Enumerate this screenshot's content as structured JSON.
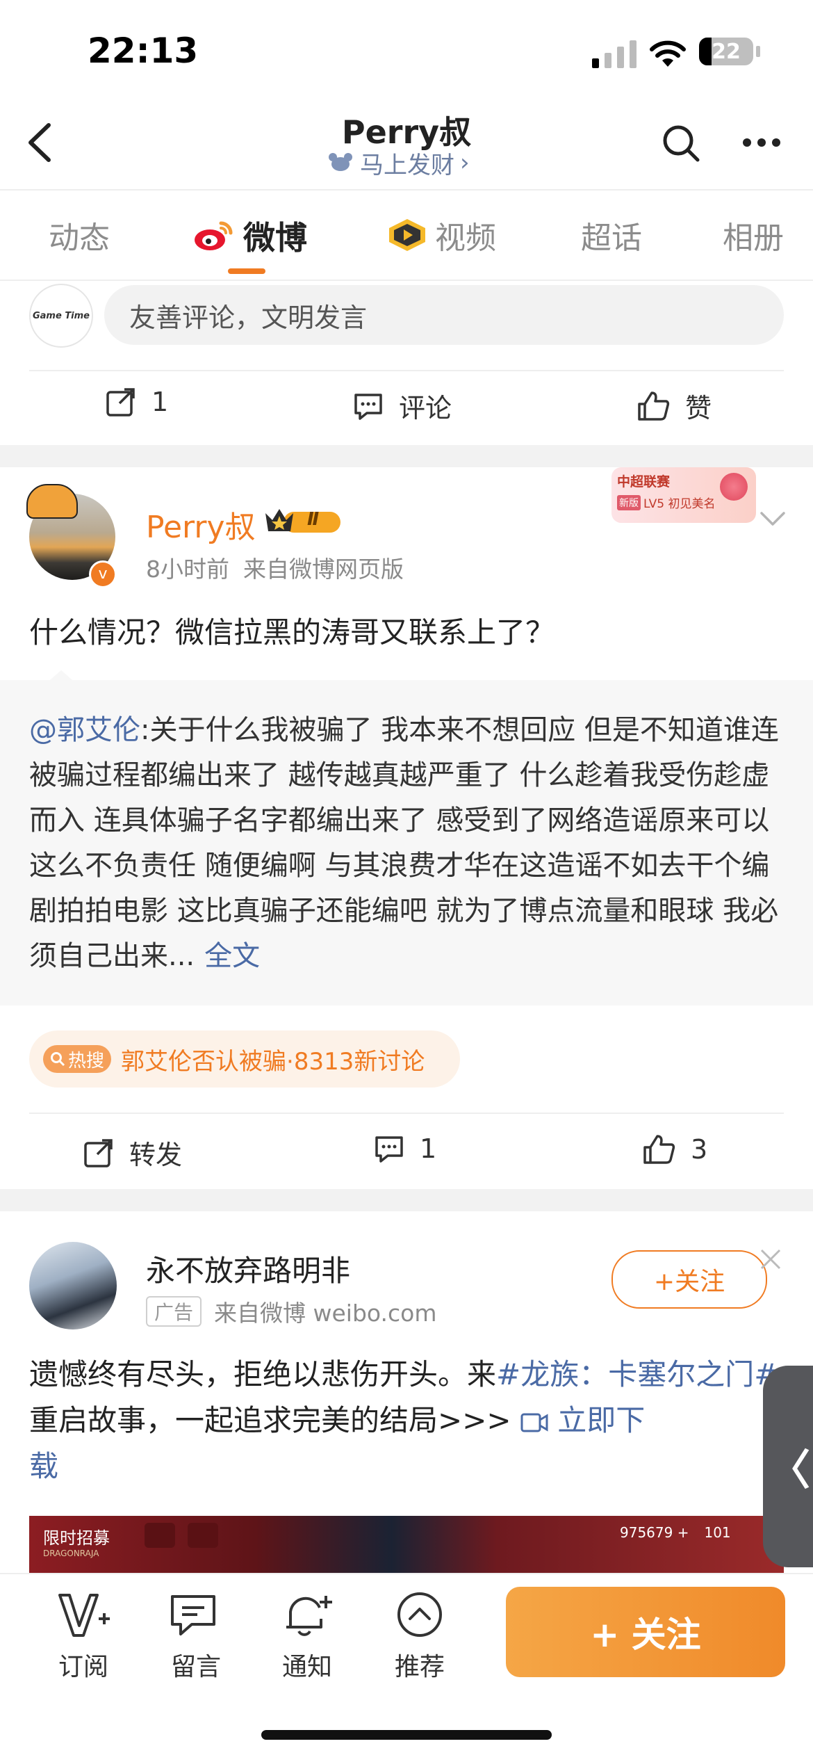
{
  "status_bar": {
    "time": "22:13",
    "battery": "22"
  },
  "nav": {
    "title": "Perry叔",
    "subtitle": "马上发财",
    "subtitle_chevron": "›"
  },
  "tabs": [
    {
      "label": "动态",
      "active": false
    },
    {
      "label": "微博",
      "active": true
    },
    {
      "label": "视频",
      "active": false
    },
    {
      "label": "超话",
      "active": false
    },
    {
      "label": "相册",
      "active": false
    }
  ],
  "comment_box": {
    "placeholder": "友善评论，文明发言",
    "avatar_text": "Game Time"
  },
  "post1_actions": {
    "repost_count": "1",
    "comment_label": "评论",
    "like_label": "赞"
  },
  "post2": {
    "author": "Perry叔",
    "badge_level": "Ⅱ",
    "time": "8小时前",
    "source": "来自微博网页版",
    "text": "什么情况？微信拉黑的涛哥又联系上了？",
    "decoration": {
      "line1": "中超联赛",
      "line2_tag": "新版",
      "line2_text": "LV5 初见美名"
    },
    "quoted": {
      "mention": "@郭艾伦",
      "text": ":关于什么我被骗了 我本来不想回应 但是不知道谁连被骗过程都编出来了 越传越真越严重了 什么趁着我受伤趁虚而入 连具体骗子名字都编出来了  感受到了网络造谣原来可以这么不负责任 随便编啊  与其浪费才华在这造谣不如去干个编剧拍拍电影  这比真骗子还能编吧 就为了博点流量和眼球 我必须自己出来...",
      "more": "全文"
    },
    "hot": {
      "tag": "热搜",
      "text": "郭艾伦否认被骗·8313新讨论"
    },
    "actions": {
      "repost_label": "转发",
      "comment_count": "1",
      "like_count": "3"
    }
  },
  "ad_post": {
    "author": "永不放弃路明非",
    "ad_label": "广告",
    "source": "来自微博 weibo.com",
    "follow_label": "+关注",
    "text_part1": "遗憾终有尽头，拒绝以悲伤开头。来",
    "hashtag": "#龙族：卡塞尔之门#",
    "text_part2": "重启故事，一起追求完美的结局>>>",
    "cta": "立即下载",
    "cta_visible": "立即下",
    "cta_wrap": "载",
    "game_banner": {
      "label": "限时招募",
      "sublabel": "DRAGONRAJA",
      "numbers": "975679 +",
      "num2": "101"
    }
  },
  "side_handle": "〈",
  "bottom_bar": {
    "items": [
      {
        "label": "订阅",
        "icon": "subscribe-icon"
      },
      {
        "label": "留言",
        "icon": "message-icon"
      },
      {
        "label": "通知",
        "icon": "bell-add-icon"
      },
      {
        "label": "推荐",
        "icon": "recommend-icon"
      }
    ],
    "follow_label": "+ 关注"
  },
  "colors": {
    "accent": "#f07b22",
    "link": "#4a6aa5",
    "follow_bg": "#f39a35"
  }
}
